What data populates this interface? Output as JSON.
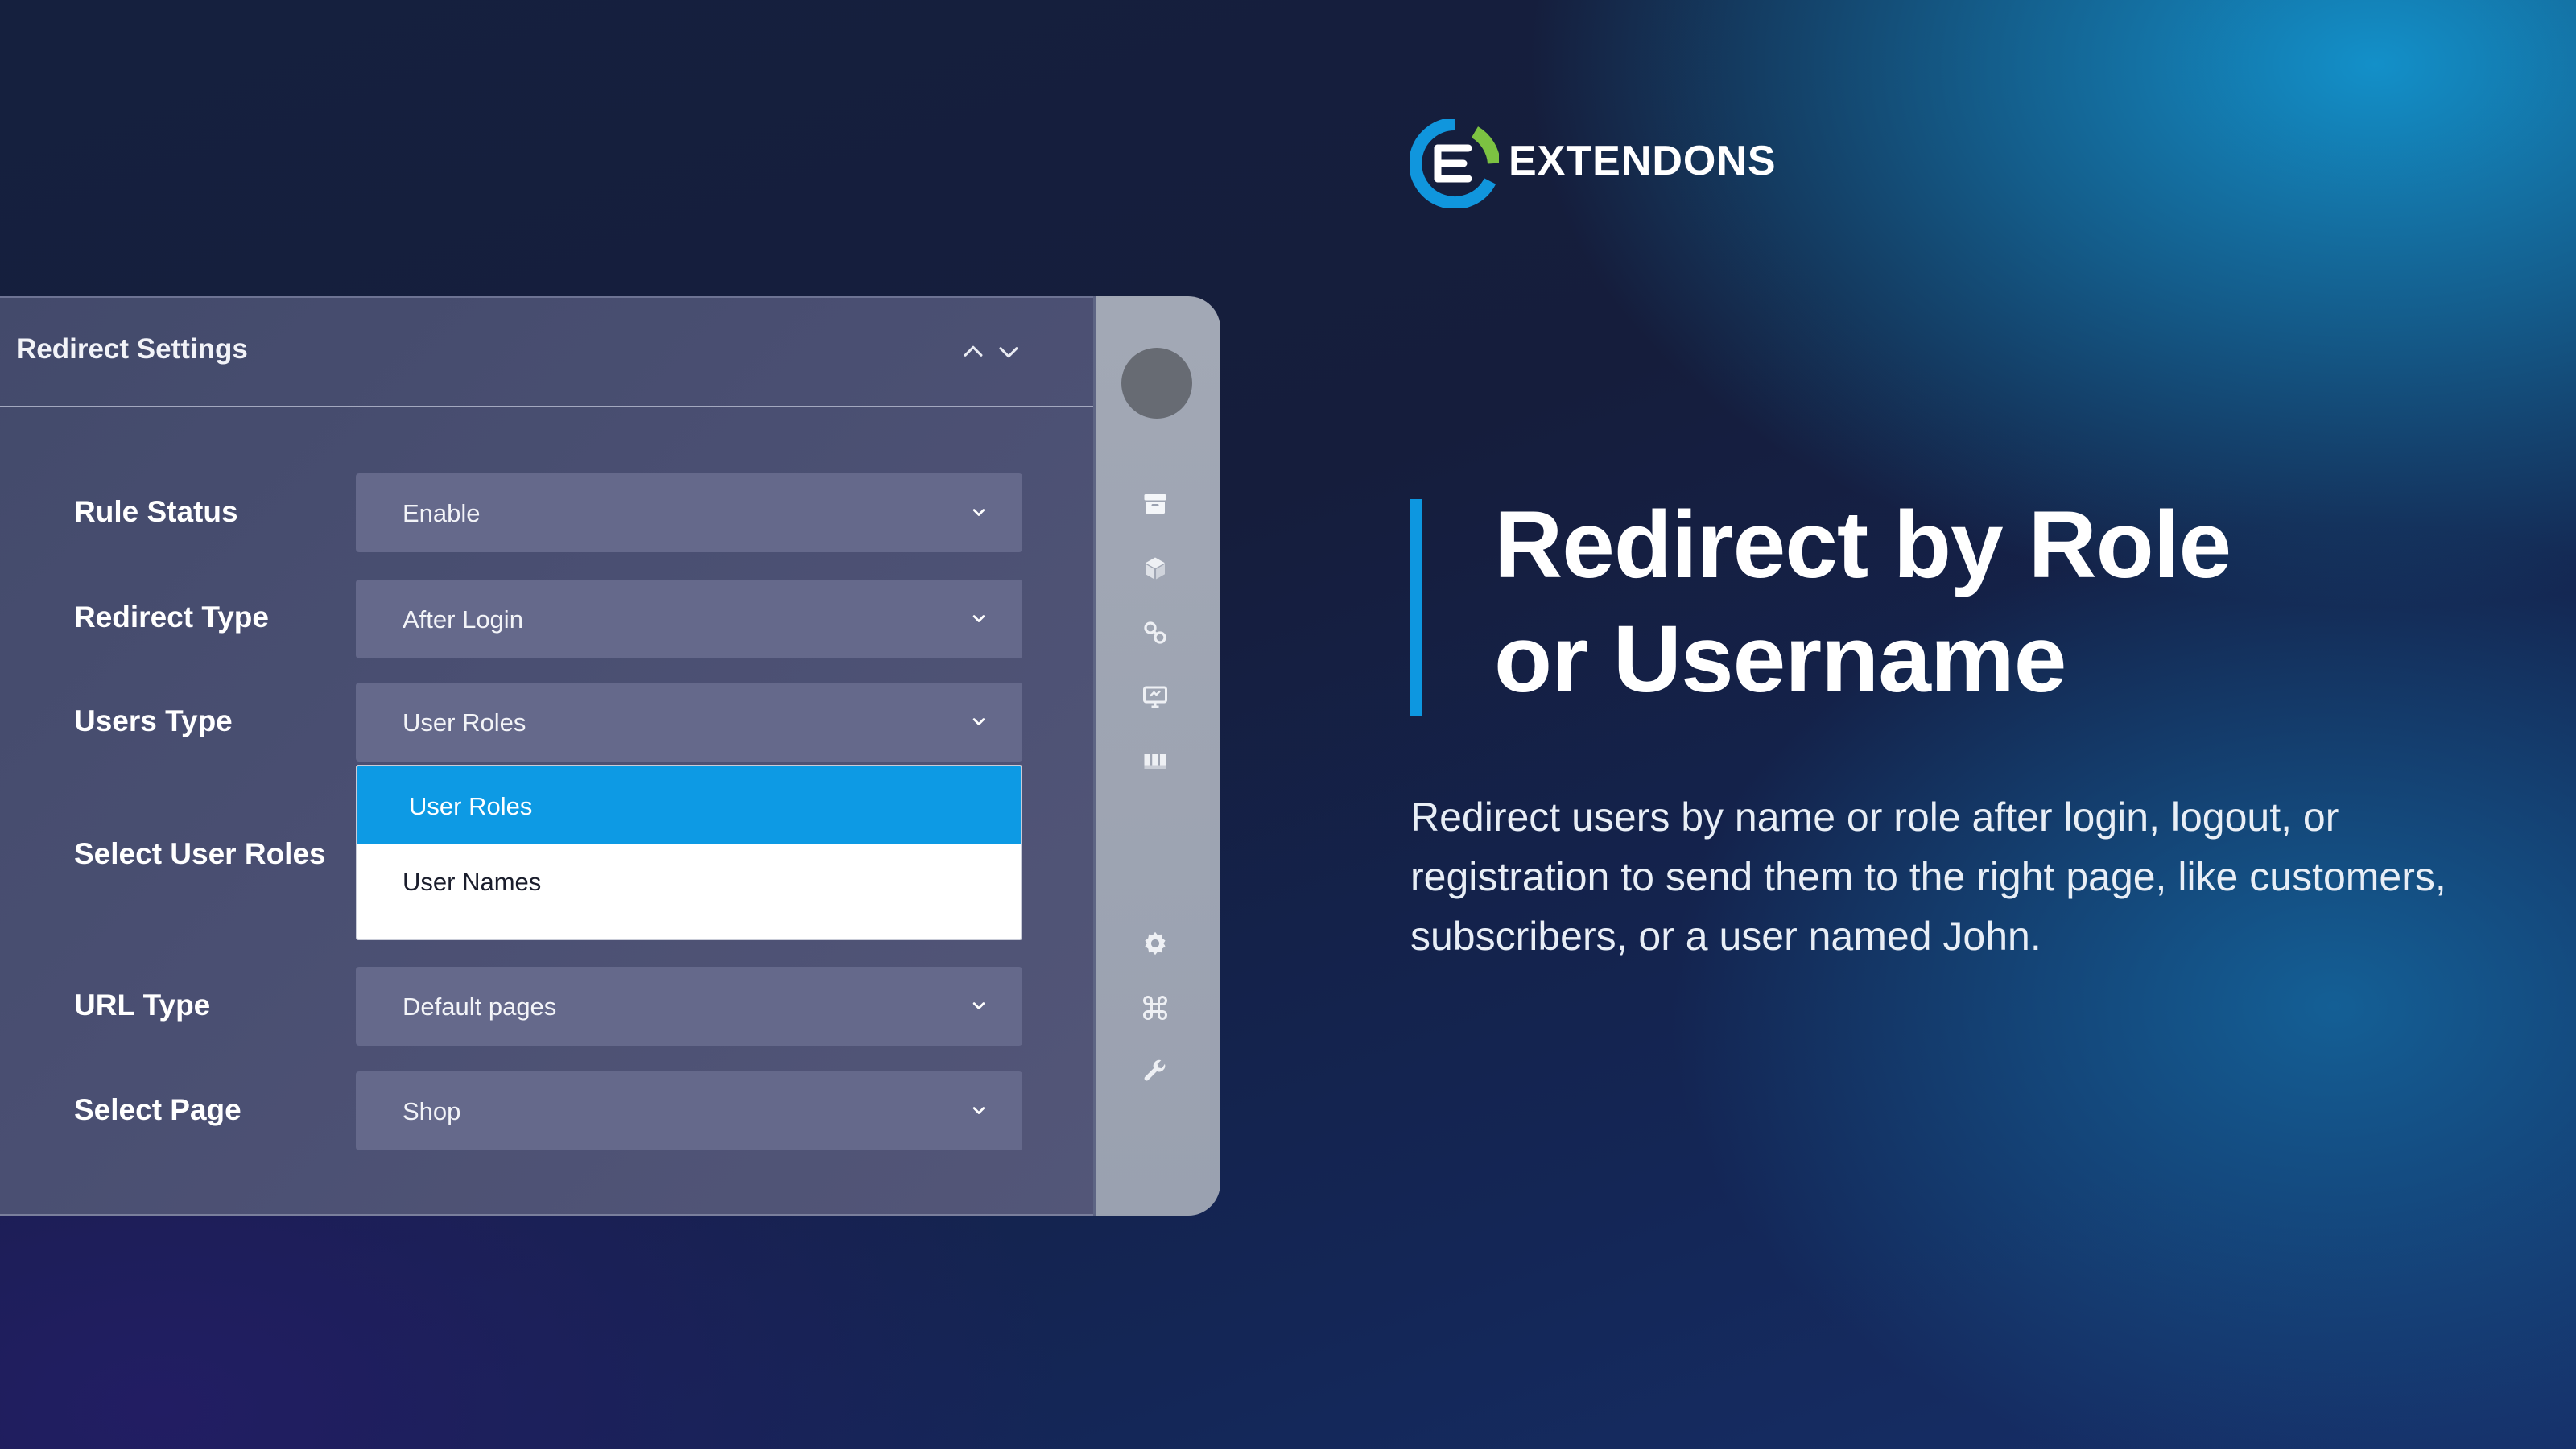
{
  "panel": {
    "title": "Redirect Settings",
    "fields": [
      {
        "label": "Rule Status",
        "value": "Enable"
      },
      {
        "label": "Redirect Type",
        "value": "After Login"
      },
      {
        "label": "Users Type",
        "value": "User Roles"
      },
      {
        "label": "Select User Roles"
      },
      {
        "label": "URL Type",
        "value": "Default pages"
      },
      {
        "label": "Select Page",
        "value": "Shop"
      }
    ],
    "dropdown_options": [
      "User Roles",
      "User Names"
    ]
  },
  "sidebar": {
    "icons": [
      "archive-icon",
      "cube-icon",
      "link-icon",
      "monitor-icon",
      "columns-icon",
      "gear-icon",
      "command-icon",
      "wrench-icon"
    ]
  },
  "brand": {
    "name": "EXTENDONS",
    "colors": {
      "blue": "#1096dd",
      "green": "#7cc242",
      "accent": "#0d97e0",
      "selected": "#0d9ae4"
    }
  },
  "hero": {
    "headline_line1": "Redirect by Role",
    "headline_line2": "or Username",
    "description": "Redirect users by name or role after login, logout, or registration to send them to the right page, like customers, subscribers, or a user named John."
  }
}
